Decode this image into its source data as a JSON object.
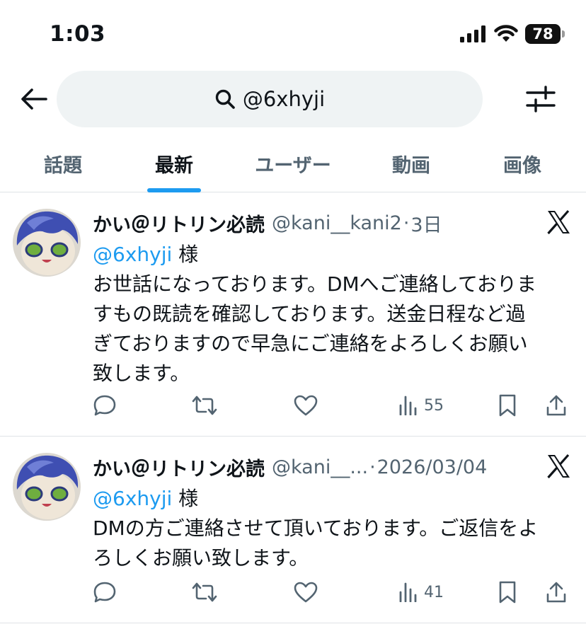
{
  "status_bar": {
    "time": "1:03",
    "battery": "78"
  },
  "search": {
    "query": "@6xhyji"
  },
  "tabs": [
    {
      "label": "話題",
      "active": false
    },
    {
      "label": "最新",
      "active": true
    },
    {
      "label": "ユーザー",
      "active": false
    },
    {
      "label": "動画",
      "active": false
    },
    {
      "label": "画像",
      "active": false
    }
  ],
  "tweets": [
    {
      "name": "かい＠リトリン必読",
      "handle": "@kani__kani2",
      "separator": "·",
      "time": "3日",
      "mention": "@6xhyji",
      "mention_suffix": " 様",
      "lines": [
        "お世話になっております。DMへご連絡しておりま",
        "すもの既読を確認しております。送金日程など過",
        "ぎておりますので早急にご連絡をよろしくお願い",
        "致します。"
      ],
      "views": "55"
    },
    {
      "name": "かい＠リトリン必読",
      "handle": "@kani__...",
      "separator": "·",
      "time": "2026/03/04",
      "mention": "@6xhyji",
      "mention_suffix": " 様",
      "lines": [
        "DMの方ご連絡させて頂いております。ご返信をよ",
        "ろしくお願い致します。"
      ],
      "views": "41"
    }
  ],
  "colors": {
    "accent": "#1d9bf0",
    "secondary_text": "#536471",
    "search_bg": "#eff3f4"
  }
}
